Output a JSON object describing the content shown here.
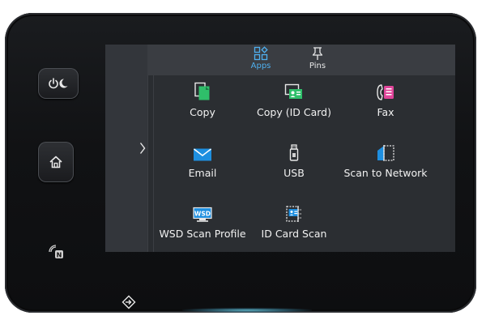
{
  "tabs": [
    {
      "label": "Apps",
      "icon": "apps-grid-icon",
      "active": true
    },
    {
      "label": "Pins",
      "icon": "pin-icon",
      "active": false
    }
  ],
  "apps": [
    {
      "label": "Copy",
      "icon": "copy-icon"
    },
    {
      "label": "Copy (ID Card)",
      "icon": "copy-id-card-icon"
    },
    {
      "label": "Fax",
      "icon": "fax-icon"
    },
    {
      "label": "Email",
      "icon": "email-icon"
    },
    {
      "label": "USB",
      "icon": "usb-icon"
    },
    {
      "label": "Scan to Network",
      "icon": "scan-to-network-icon"
    },
    {
      "label": "WSD Scan Profile",
      "icon": "wsd-scan-icon"
    },
    {
      "label": "ID Card Scan",
      "icon": "id-card-scan-icon"
    }
  ],
  "wsd_icon_text": "WSD",
  "nfc_icon_text": "N",
  "colors": {
    "accent_blue": "#4fb0ef",
    "copy_green": "#2fbf6a",
    "fax_pink": "#e0459a",
    "email_blue": "#1e8fe0",
    "usb_gray": "#d0d0d0",
    "screen_bg": "#2a2d31",
    "bezel": "#111214"
  },
  "hardware_buttons": [
    {
      "name": "power-sleep",
      "icon": "power-sleep-icon"
    },
    {
      "name": "home",
      "icon": "home-icon"
    }
  ]
}
